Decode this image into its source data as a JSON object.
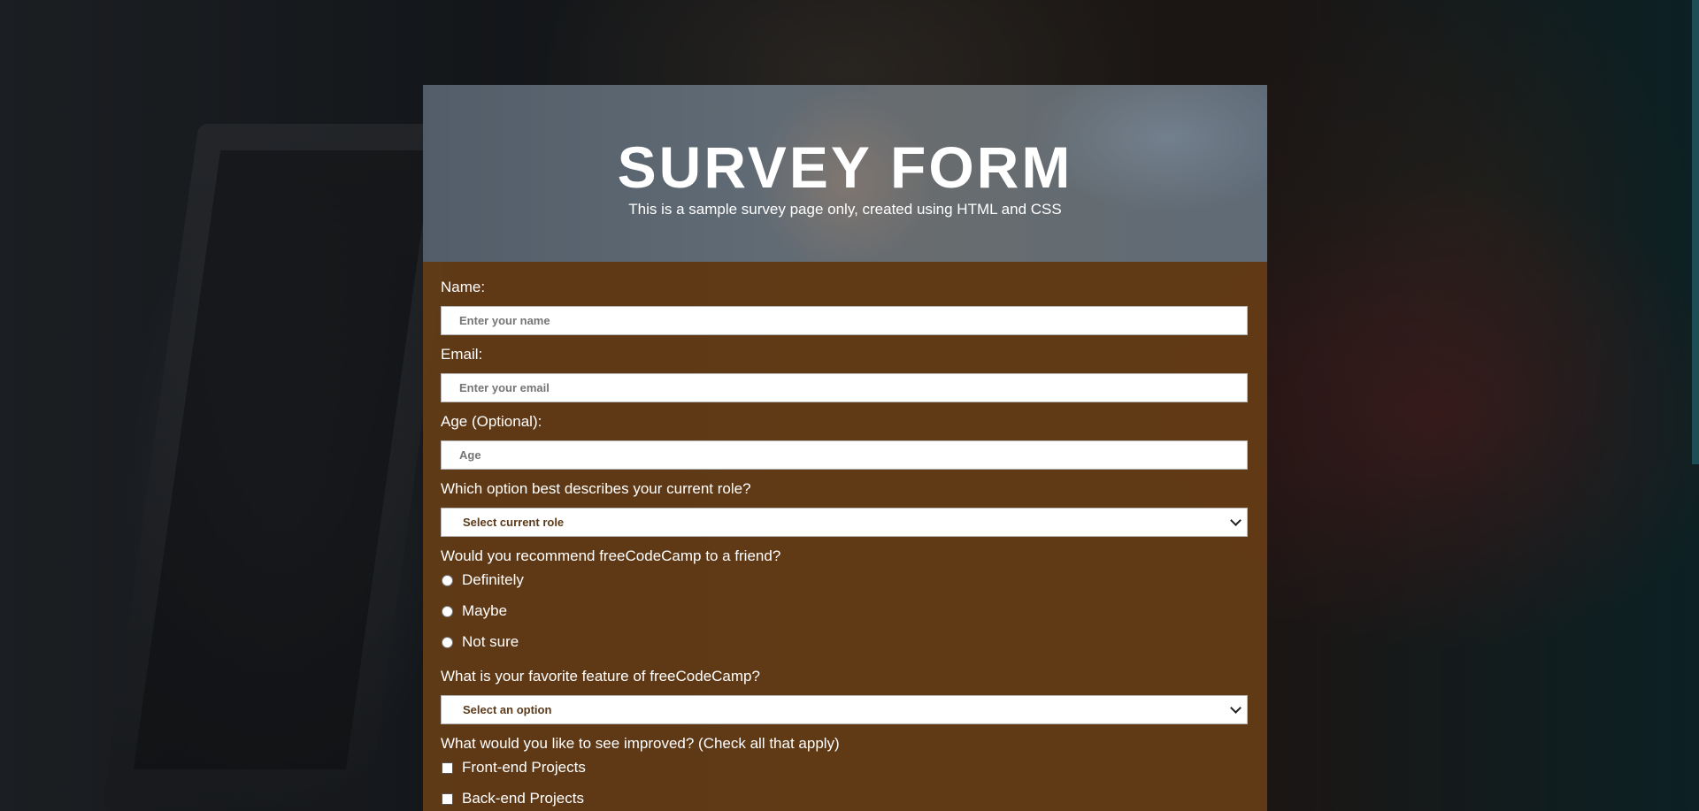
{
  "header": {
    "title": "SURVEY FORM",
    "subtitle": "This is a sample survey page only, created using HTML and CSS"
  },
  "form": {
    "name": {
      "label": "Name:",
      "placeholder": "Enter your name"
    },
    "email": {
      "label": "Email:",
      "placeholder": "Enter your email"
    },
    "age": {
      "label": "Age (Optional):",
      "placeholder": "Age"
    },
    "role": {
      "label": "Which option best describes your current role?",
      "selected": "Select current role"
    },
    "recommend": {
      "label": "Would you recommend freeCodeCamp to a friend?",
      "options": [
        "Definitely",
        "Maybe",
        "Not sure"
      ]
    },
    "feature": {
      "label": "What is your favorite feature of freeCodeCamp?",
      "selected": "Select an option"
    },
    "improve": {
      "label": "What would you like to see improved? (Check all that apply)",
      "options": [
        "Front-end Projects",
        "Back-end Projects"
      ]
    }
  },
  "icons": {
    "dropdown": "chevron-down-icon",
    "radio": "radio-button-icon",
    "checkbox": "checkbox-icon"
  },
  "colors": {
    "form_background": "#6a3f16",
    "label_text": "#ffffff",
    "select_text": "#5a3a1a"
  }
}
